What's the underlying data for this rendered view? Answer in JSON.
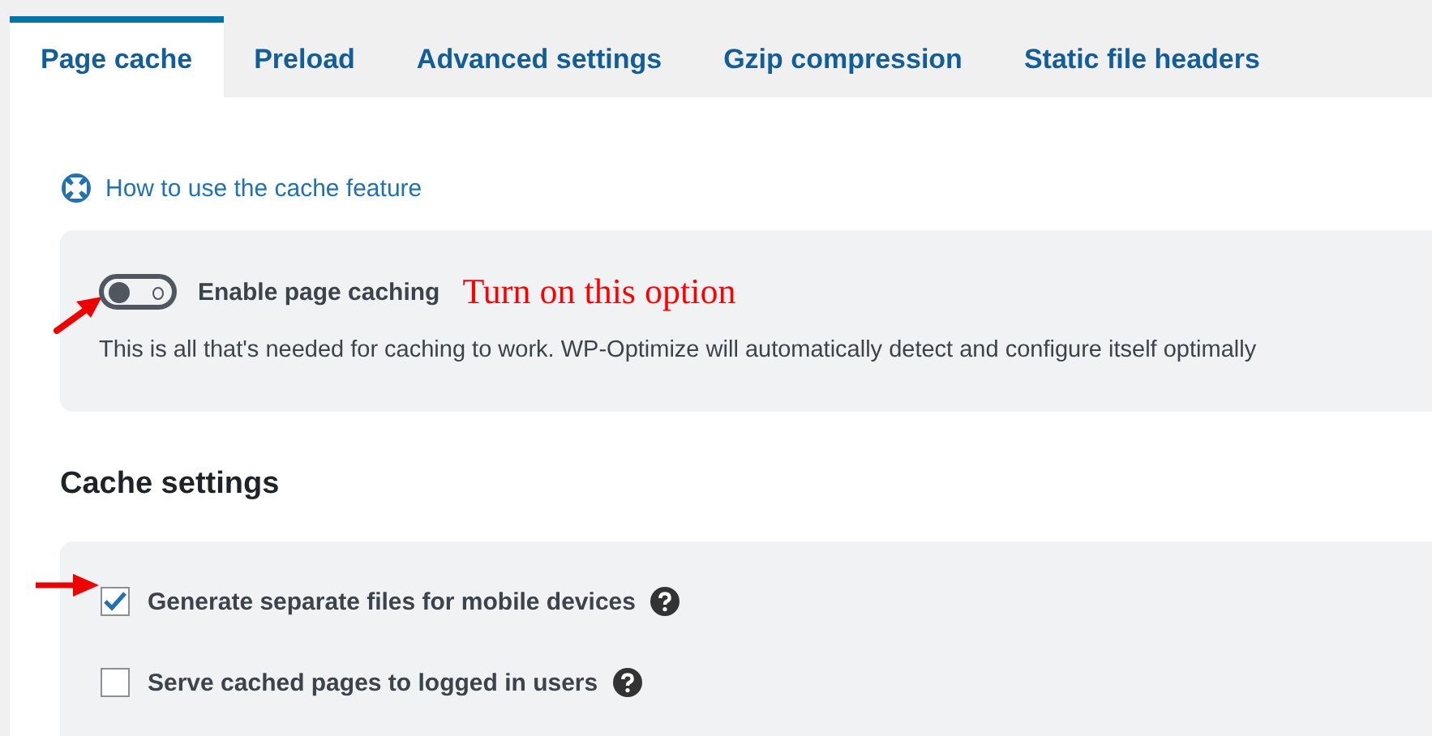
{
  "tabs": [
    {
      "label": "Page cache",
      "selected": true
    },
    {
      "label": "Preload",
      "selected": false
    },
    {
      "label": "Advanced settings",
      "selected": false
    },
    {
      "label": "Gzip compression",
      "selected": false
    },
    {
      "label": "Static file headers",
      "selected": false
    }
  ],
  "help_link": "How to use the cache feature",
  "page_caching": {
    "label": "Enable page caching",
    "on": false,
    "description": "This is all that's needed for caching to work. WP-Optimize will automatically detect and configure itself optimally"
  },
  "annotation": "Turn on this option",
  "cache_settings": {
    "heading": "Cache settings",
    "options": [
      {
        "label": "Generate separate files for mobile devices",
        "checked": true,
        "arrow": true
      },
      {
        "label": "Serve cached pages to logged in users",
        "checked": false,
        "arrow": false
      }
    ]
  }
}
